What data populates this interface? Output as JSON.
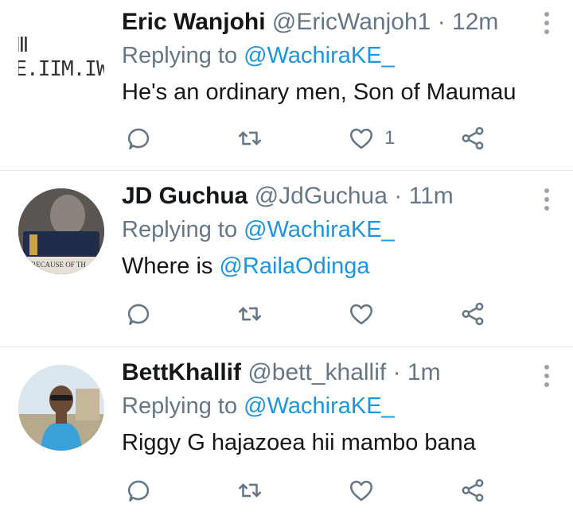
{
  "replying_label": "Replying to",
  "tweets": [
    {
      "avatar_text": "Ⅲ E.IIM.IW",
      "name": "Eric Wanjohi",
      "handle": "@EricWanjoh1",
      "time": "12m",
      "reply_to": "@WachiraKE_",
      "text": "He's an ordinary men, Son of Maumau",
      "like_count": "1"
    },
    {
      "avatar_text": "BECAUSE OF TH",
      "name": "JD Guchua",
      "handle": "@JdGuchua",
      "time": "11m",
      "reply_to": "@WachiraKE_",
      "text_prefix": "Where is ",
      "text_mention": "@RailaOdinga"
    },
    {
      "name": "BettKhallif",
      "handle": "@bett_khallif",
      "time": "1m",
      "reply_to": "@WachiraKE_",
      "text": "Riggy G hajazoea hii mambo bana"
    }
  ],
  "colors": {
    "link": "#1b95e0",
    "muted": "#657786",
    "divider": "#e1e8ed"
  },
  "icons": [
    "reply-icon",
    "retweet-icon",
    "like-icon",
    "share-icon",
    "more-options-icon"
  ]
}
